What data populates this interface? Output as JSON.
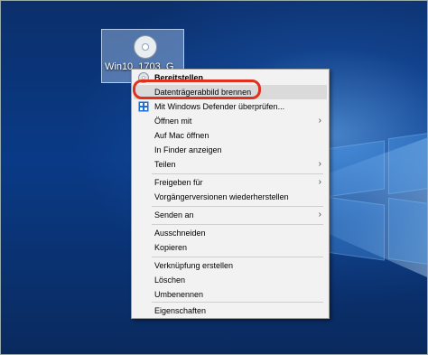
{
  "desktop": {
    "icon": {
      "label": "Win10_1703_G"
    }
  },
  "menu": {
    "items": [
      {
        "label": "Bereitstellen",
        "bold": true,
        "icon": "disc-icon"
      },
      {
        "label": "Datenträgerabbild brennen",
        "highlighted": true
      },
      {
        "label": "Mit Windows Defender überprüfen...",
        "icon": "defender-icon"
      },
      {
        "label": "Öffnen mit",
        "submenu": true
      },
      {
        "label": "Auf Mac öffnen"
      },
      {
        "label": "In Finder anzeigen"
      },
      {
        "label": "Teilen",
        "submenu": true
      },
      {
        "label": "Freigeben für",
        "submenu": true
      },
      {
        "label": "Vorgängerversionen wiederherstellen"
      },
      {
        "label": "Senden an",
        "submenu": true
      },
      {
        "label": "Ausschneiden"
      },
      {
        "label": "Kopieren"
      },
      {
        "label": "Verknüpfung erstellen"
      },
      {
        "label": "Löschen"
      },
      {
        "label": "Umbenennen"
      },
      {
        "label": "Eigenschaften"
      }
    ],
    "submenu_glyph": "›"
  },
  "colors": {
    "highlight_ring": "#e0301e",
    "menu_bg": "#f2f2f2",
    "hover_bg": "#dadada",
    "defender_blue": "#1f6fd6"
  }
}
